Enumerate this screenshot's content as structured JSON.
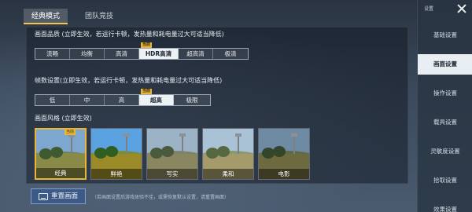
{
  "tabs": [
    "经典模式",
    "团队竞技"
  ],
  "quality": {
    "title": "画面品质 (立即生效，若运行卡顿，发热量和耗电量过大可适当降低)",
    "options": [
      "流畅",
      "均衡",
      "高清",
      "HDR高清",
      "超高清",
      "极清"
    ],
    "selected": "HDR高清",
    "current_tag": "当前"
  },
  "framerate": {
    "title": "帧数设置(立即生效，若运行卡顿，发热量和耗电量过大可适当降低)",
    "options": [
      "低",
      "中",
      "高",
      "超高",
      "极限"
    ],
    "selected": "超高",
    "current_tag": "当前"
  },
  "style": {
    "title": "画面风格 (立即生效)",
    "current_tag": "当前",
    "options": [
      {
        "label": "经典",
        "sky": "#7ea7cf",
        "ground": "#8a8a48",
        "hill": "#6f7e56",
        "tree": "#3e5a2e"
      },
      {
        "label": "鲜艳",
        "sky": "#5aa3e0",
        "ground": "#9a8a28",
        "hill": "#7a8d3c",
        "tree": "#2f5e22"
      },
      {
        "label": "写实",
        "sky": "#9cb3c6",
        "ground": "#8a8660",
        "hill": "#7a8468",
        "tree": "#4a5a3c"
      },
      {
        "label": "柔和",
        "sky": "#a9c2d6",
        "ground": "#a49a6a",
        "hill": "#8a9870",
        "tree": "#56683f"
      },
      {
        "label": "电影",
        "sky": "#6f8aa3",
        "ground": "#6d6a40",
        "hill": "#5c6a46",
        "tree": "#34462a"
      }
    ],
    "selected": "经典"
  },
  "reset": {
    "label": "重置画面",
    "note": "（若画面设置后游戏体验不佳，或需恢复默认设置，请重置画面）"
  },
  "sidebar": {
    "title": "设置",
    "items": [
      "基础设置",
      "画面设置",
      "操作设置",
      "载具设置",
      "灵敏度设置",
      "拾取设置",
      "效果设置"
    ],
    "active": "画面设置"
  },
  "colors": {
    "accent": "#e8b53a",
    "selected_bg": "#eef2f5",
    "reset_bg": "#3d5a86"
  }
}
